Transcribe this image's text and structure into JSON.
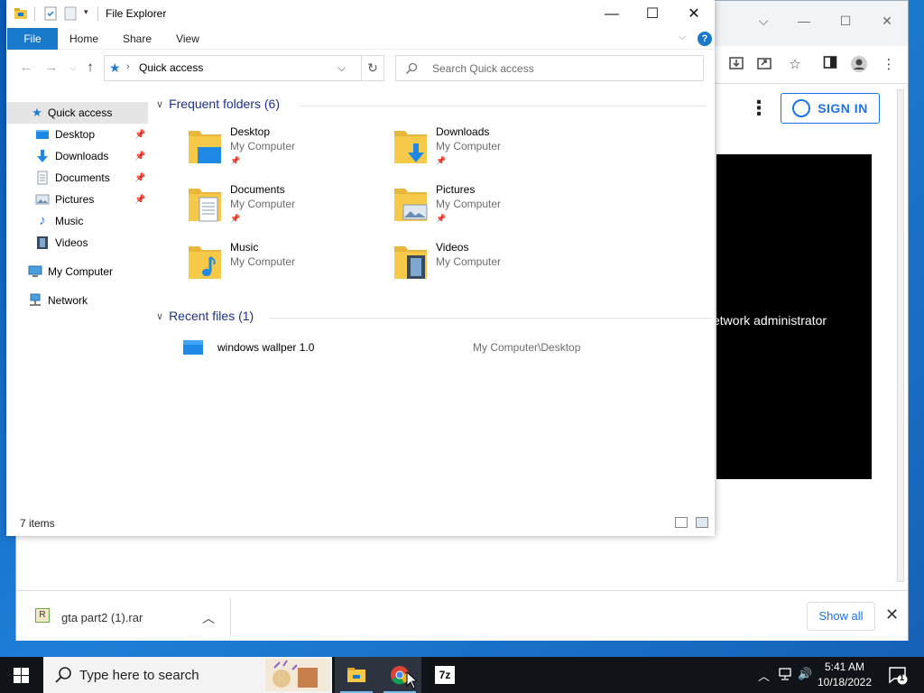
{
  "explorer": {
    "title": "File Explorer",
    "ribbon_tabs": [
      "File",
      "Home",
      "Share",
      "View"
    ],
    "address": "Quick access",
    "search_placeholder": "Search Quick access",
    "sidebar": [
      {
        "label": "Quick access",
        "icon": "star-icon",
        "selected": true,
        "pinned": false
      },
      {
        "label": "Desktop",
        "icon": "desktop-icon",
        "pinned": true
      },
      {
        "label": "Downloads",
        "icon": "download-arrow-icon",
        "pinned": true
      },
      {
        "label": "Documents",
        "icon": "documents-icon",
        "pinned": true
      },
      {
        "label": "Pictures",
        "icon": "pictures-icon",
        "pinned": true
      },
      {
        "label": "Music",
        "icon": "music-note-icon",
        "pinned": false
      },
      {
        "label": "Videos",
        "icon": "film-icon",
        "pinned": false
      },
      {
        "label": "My Computer",
        "icon": "computer-icon",
        "pinned": false
      },
      {
        "label": "Network",
        "icon": "network-icon",
        "pinned": false
      }
    ],
    "frequent_header": "Frequent folders (6)",
    "folders": [
      {
        "name": "Desktop",
        "location": "My Computer",
        "pinned": true
      },
      {
        "name": "Downloads",
        "location": "My Computer",
        "pinned": true
      },
      {
        "name": "Documents",
        "location": "My Computer",
        "pinned": true
      },
      {
        "name": "Pictures",
        "location": "My Computer",
        "pinned": true
      },
      {
        "name": "Music",
        "location": "My Computer",
        "pinned": false
      },
      {
        "name": "Videos",
        "location": "My Computer",
        "pinned": false
      }
    ],
    "recent_header": "Recent files (1)",
    "recent_files": [
      {
        "name": "windows wallper 1.0",
        "location": "My Computer\\Desktop"
      }
    ],
    "status": "7 items"
  },
  "browser": {
    "sign_in": "SIGN IN",
    "video_text": "etwork administrator",
    "download": {
      "file": "gta part2 (1).rar",
      "show_all": "Show all"
    }
  },
  "taskbar": {
    "search_placeholder": "Type here to search",
    "time": "5:41 AM",
    "date": "10/18/2022",
    "notification_count": "1"
  },
  "colors": {
    "accent": "#1979ca",
    "taskbar": "#101418",
    "folder": "#f7c948",
    "link": "#1a73e8"
  }
}
